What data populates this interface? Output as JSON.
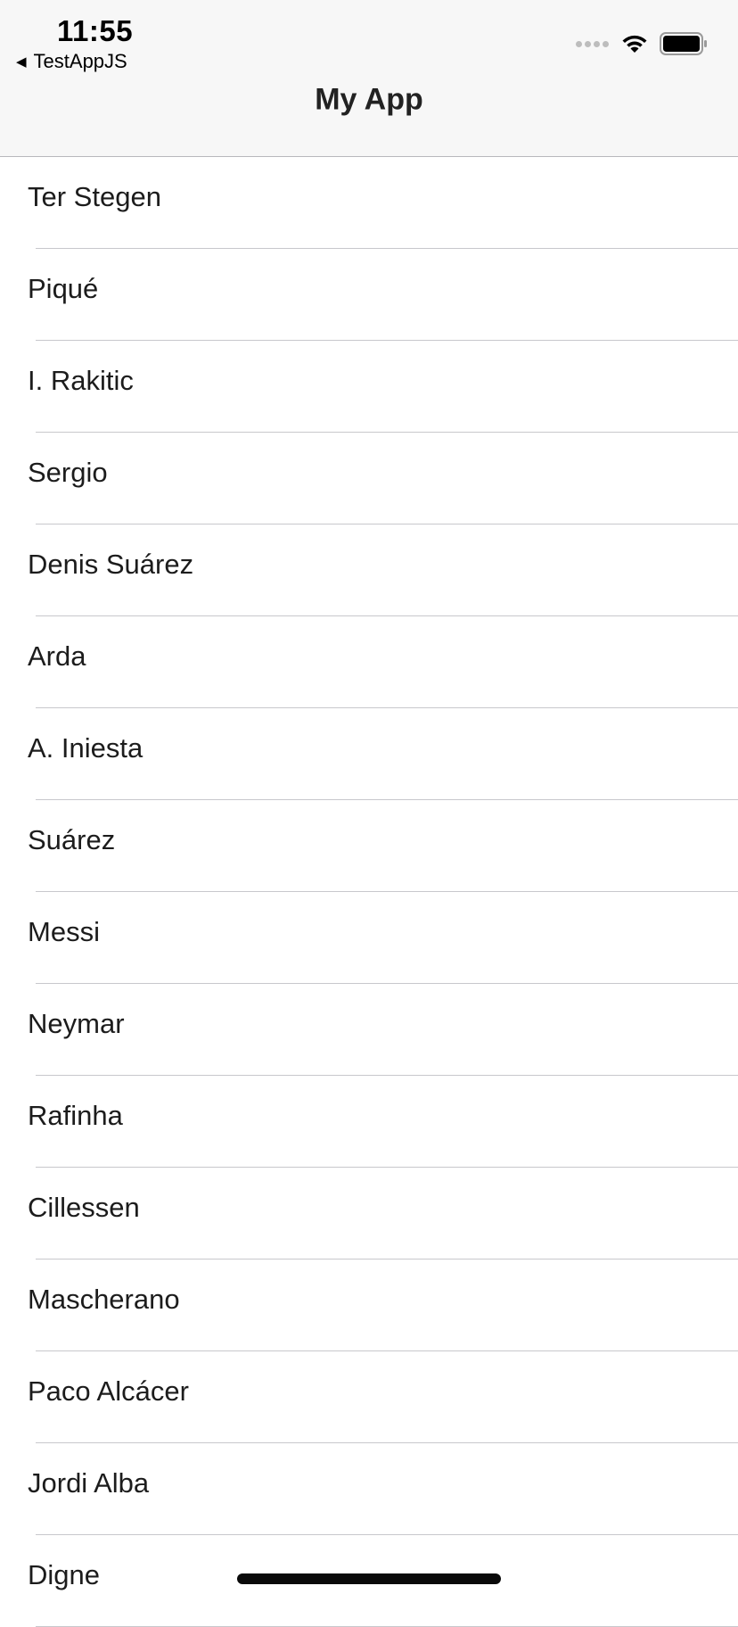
{
  "status_bar": {
    "time": "11:55",
    "back_app": "TestAppJS",
    "back_glyph": "◀",
    "icons": [
      "signal-icon",
      "wifi-icon",
      "battery-icon"
    ]
  },
  "nav": {
    "title": "My App"
  },
  "list": {
    "items": [
      "Ter Stegen",
      "Piqué",
      "I. Rakitic",
      "Sergio",
      "Denis Suárez",
      "Arda",
      "A. Iniesta",
      "Suárez",
      "Messi",
      "Neymar",
      "Rafinha",
      "Cillessen",
      "Mascherano",
      "Paco Alcácer",
      "Jordi Alba",
      "Digne"
    ]
  },
  "colors": {
    "header_bg": "#f7f7f7",
    "separator": "#c8c8cc",
    "text": "#1c1c1c"
  }
}
